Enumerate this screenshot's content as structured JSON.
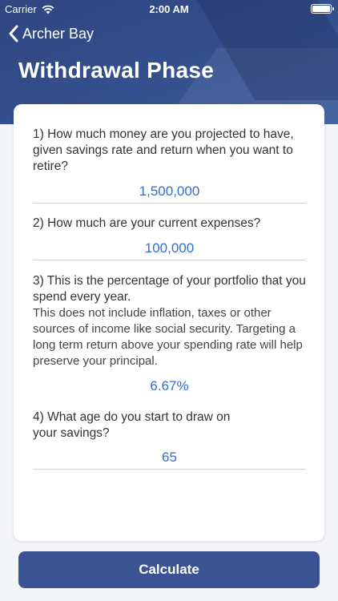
{
  "status_bar": {
    "carrier": "Carrier",
    "time": "2:00 AM"
  },
  "nav": {
    "back_label": "Archer Bay",
    "title": "Withdrawal Phase"
  },
  "questions": [
    {
      "text": "1) How much money are you projected to have, given savings rate and return when you want to retire?",
      "value": "1,500,000"
    },
    {
      "text": "2) How much are your current expenses?",
      "value": "100,000"
    },
    {
      "text": "3) This is the percentage of your portfolio that you spend every year.",
      "note": "This does not include inflation, taxes or other sources of income like social security. Targeting a long term return above your spending rate will help preserve your principal.",
      "value": "6.67%"
    },
    {
      "text": "4) What age do you start to draw on your savings?",
      "value": "65"
    }
  ],
  "calculate_label": "Calculate",
  "colors": {
    "header": "#34508e",
    "accent": "#2f6fd1",
    "button": "#3a5393"
  }
}
